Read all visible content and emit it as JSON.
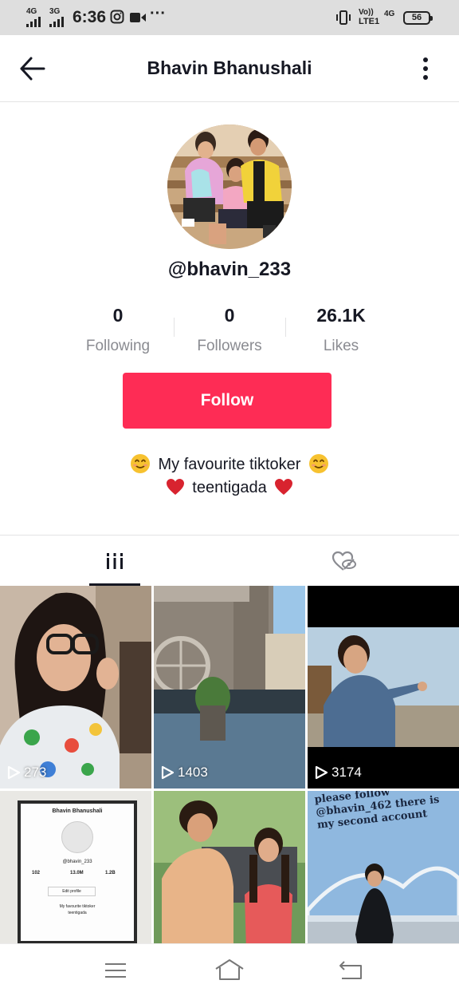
{
  "status_bar": {
    "net1": "4G",
    "net2": "3G",
    "time": "6:36",
    "dots": "···",
    "volte_top": "Vo))",
    "volte_bottom": "LTE1",
    "net3": "4G",
    "battery": "56"
  },
  "header": {
    "title": "Bhavin Bhanushali"
  },
  "profile": {
    "username": "@bhavin_233",
    "stats": [
      {
        "value": "0",
        "label": "Following"
      },
      {
        "value": "0",
        "label": "Followers"
      },
      {
        "value": "26.1K",
        "label": "Likes"
      }
    ],
    "follow_label": "Follow",
    "bio_line1": "My favourite tiktoker",
    "bio_line2": "teentigada"
  },
  "tabs": [
    {
      "icon": "videos-grid-icon",
      "active": true
    },
    {
      "icon": "liked-hidden-icon",
      "active": false
    }
  ],
  "videos": [
    {
      "views": "273"
    },
    {
      "views": "1403"
    },
    {
      "views": "3174"
    },
    {
      "views": ""
    },
    {
      "views": ""
    },
    {
      "views": ""
    }
  ],
  "thumb4": {
    "name": "Bhavin Bhanushali",
    "handle": "@bhavin_233",
    "stats": [
      "102",
      "13.0M",
      "1.2B"
    ],
    "button": "Edit profile",
    "bio1": "My favourite tiktoker",
    "bio2": "teentigada"
  },
  "thumb6_text": "please follow @bhavin_462 there is my second account",
  "colors": {
    "accent": "#fe2c55",
    "text_primary": "#161823",
    "text_secondary": "#8a8b91"
  }
}
